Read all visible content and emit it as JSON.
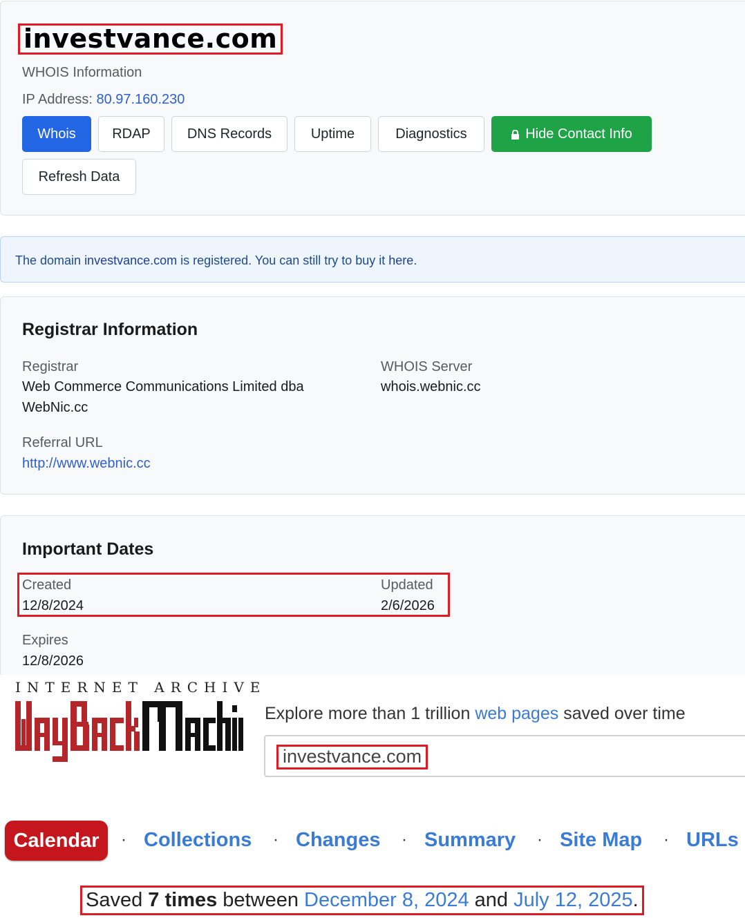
{
  "header": {
    "domain": "investvance.com",
    "subtitle": "WHOIS Information",
    "ip_label": "IP Address: ",
    "ip_value": "80.97.160.230",
    "buttons": [
      "Whois",
      "RDAP",
      "DNS Records",
      "Uptime",
      "Diagnostics",
      "Hide Contact Info",
      "Refresh Data"
    ]
  },
  "alert": {
    "prefix": "The domain ",
    "domain": "investvance.com",
    "middle": " is registered. You can still try to buy it ",
    "link": "here",
    "suffix": "."
  },
  "registrar": {
    "title": "Registrar Information",
    "registrar_label": "Registrar",
    "registrar_value_line1": "Web Commerce Communications Limited dba",
    "registrar_value_line2": "WebNic.cc",
    "whois_server_label": "WHOIS Server",
    "whois_server_value": "whois.webnic.cc",
    "referral_label": "Referral URL",
    "referral_value": "http://www.webnic.cc"
  },
  "dates": {
    "title": "Important Dates",
    "created_label": "Created",
    "created_value": "12/8/2024",
    "updated_label": "Updated",
    "updated_value": "2/6/2026",
    "expires_label": "Expires",
    "expires_value": "12/8/2026"
  },
  "wayback": {
    "ia_text": "INTERNET ARCHIVE",
    "explore_prefix": "Explore more than 1 trillion ",
    "explore_link": "web pages",
    "explore_suffix": " saved over time",
    "search_value": "investvance.com",
    "nav": [
      "Calendar",
      "Collections",
      "Changes",
      "Summary",
      "Site Map",
      "URLs"
    ],
    "saved_prefix": "Saved ",
    "saved_count": "7 times",
    "saved_between": " between ",
    "saved_from": "December 8, 2024",
    "saved_and": " and ",
    "saved_to": "July 12, 2025",
    "saved_end": "."
  },
  "colors": {
    "primary": "#2266e3",
    "success": "#1ea446",
    "wayback_red": "#c4161c",
    "highlight": "#e01b24"
  }
}
